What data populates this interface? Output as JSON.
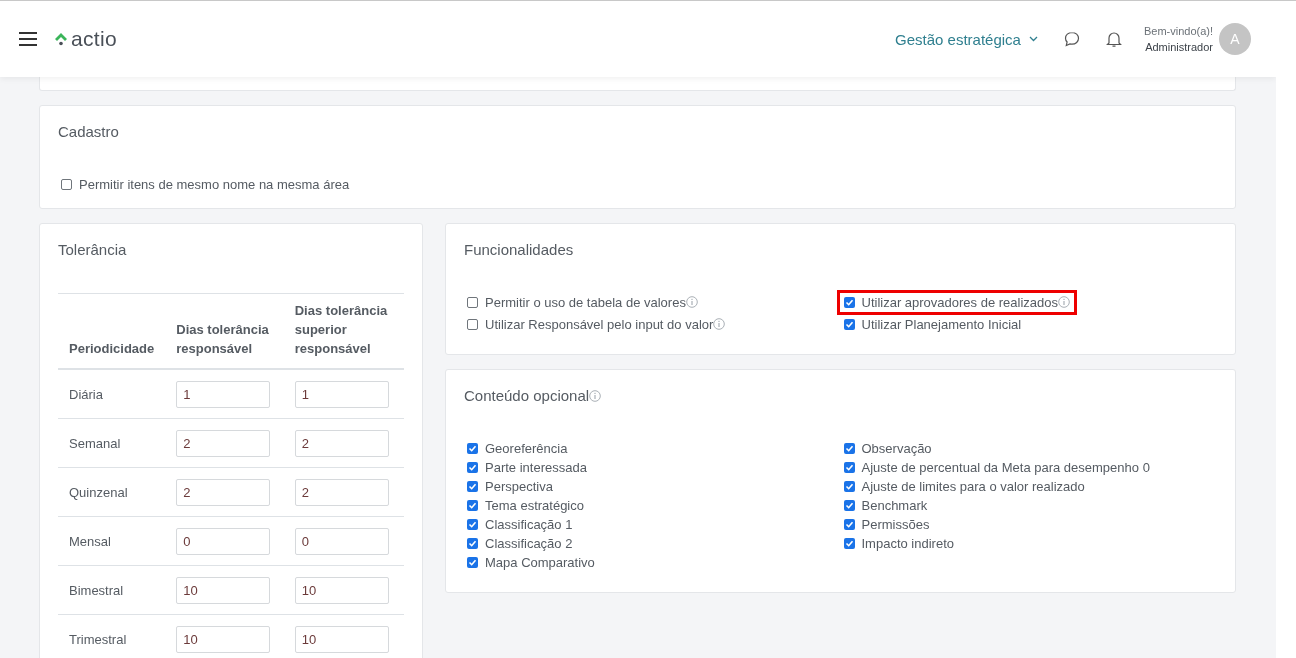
{
  "header": {
    "logo": "actio",
    "module_menu": "Gestão estratégica",
    "greeting": "Bem-vindo(a)!",
    "user_name": "Administrador",
    "avatar_initial": "A"
  },
  "cadastro": {
    "title": "Cadastro",
    "options": [
      {
        "label": "Permitir itens de mesmo nome na mesma área",
        "checked": false,
        "info": false,
        "highlighted": false
      }
    ]
  },
  "tolerancia": {
    "title": "Tolerância",
    "columns": [
      "Periodicidade",
      "Dias tolerância responsável",
      "Dias tolerância superior responsável"
    ],
    "rows": [
      {
        "period": "Diária",
        "responsavel": "1",
        "superior": "1"
      },
      {
        "period": "Semanal",
        "responsavel": "2",
        "superior": "2"
      },
      {
        "period": "Quinzenal",
        "responsavel": "2",
        "superior": "2"
      },
      {
        "period": "Mensal",
        "responsavel": "0",
        "superior": "0"
      },
      {
        "period": "Bimestral",
        "responsavel": "10",
        "superior": "10"
      },
      {
        "period": "Trimestral",
        "responsavel": "10",
        "superior": "10"
      }
    ]
  },
  "funcionalidades": {
    "title": "Funcionalidades",
    "title_info": false,
    "columns": [
      [
        {
          "label": "Permitir o uso de tabela de valores",
          "checked": false,
          "info": true,
          "highlighted": false
        },
        {
          "label": "Utilizar Responsável pelo input do valor",
          "checked": false,
          "info": true,
          "highlighted": false
        }
      ],
      [
        {
          "label": "Utilizar aprovadores de realizados",
          "checked": true,
          "info": true,
          "highlighted": true
        },
        {
          "label": "Utilizar Planejamento Inicial",
          "checked": true,
          "info": false,
          "highlighted": false
        }
      ]
    ]
  },
  "conteudo_opcional": {
    "title": "Conteúdo opcional",
    "title_info": true,
    "columns": [
      [
        {
          "label": "Georeferência",
          "checked": true,
          "info": false,
          "highlighted": false
        },
        {
          "label": "Parte interessada",
          "checked": true,
          "info": false,
          "highlighted": false
        },
        {
          "label": "Perspectiva",
          "checked": true,
          "info": false,
          "highlighted": false
        },
        {
          "label": "Tema estratégico",
          "checked": true,
          "info": false,
          "highlighted": false
        },
        {
          "label": "Classificação 1",
          "checked": true,
          "info": false,
          "highlighted": false
        },
        {
          "label": "Classificação 2",
          "checked": true,
          "info": false,
          "highlighted": false
        },
        {
          "label": "Mapa Comparativo",
          "checked": true,
          "info": false,
          "highlighted": false
        }
      ],
      [
        {
          "label": "Observação",
          "checked": true,
          "info": false,
          "highlighted": false
        },
        {
          "label": "Ajuste de percentual da Meta para desempenho 0",
          "checked": true,
          "info": false,
          "highlighted": false
        },
        {
          "label": "Ajuste de limites para o valor realizado",
          "checked": true,
          "info": false,
          "highlighted": false
        },
        {
          "label": "Benchmark",
          "checked": true,
          "info": false,
          "highlighted": false
        },
        {
          "label": "Permissões",
          "checked": true,
          "info": false,
          "highlighted": false
        },
        {
          "label": "Impacto indireto",
          "checked": true,
          "info": false,
          "highlighted": false
        }
      ]
    ]
  }
}
